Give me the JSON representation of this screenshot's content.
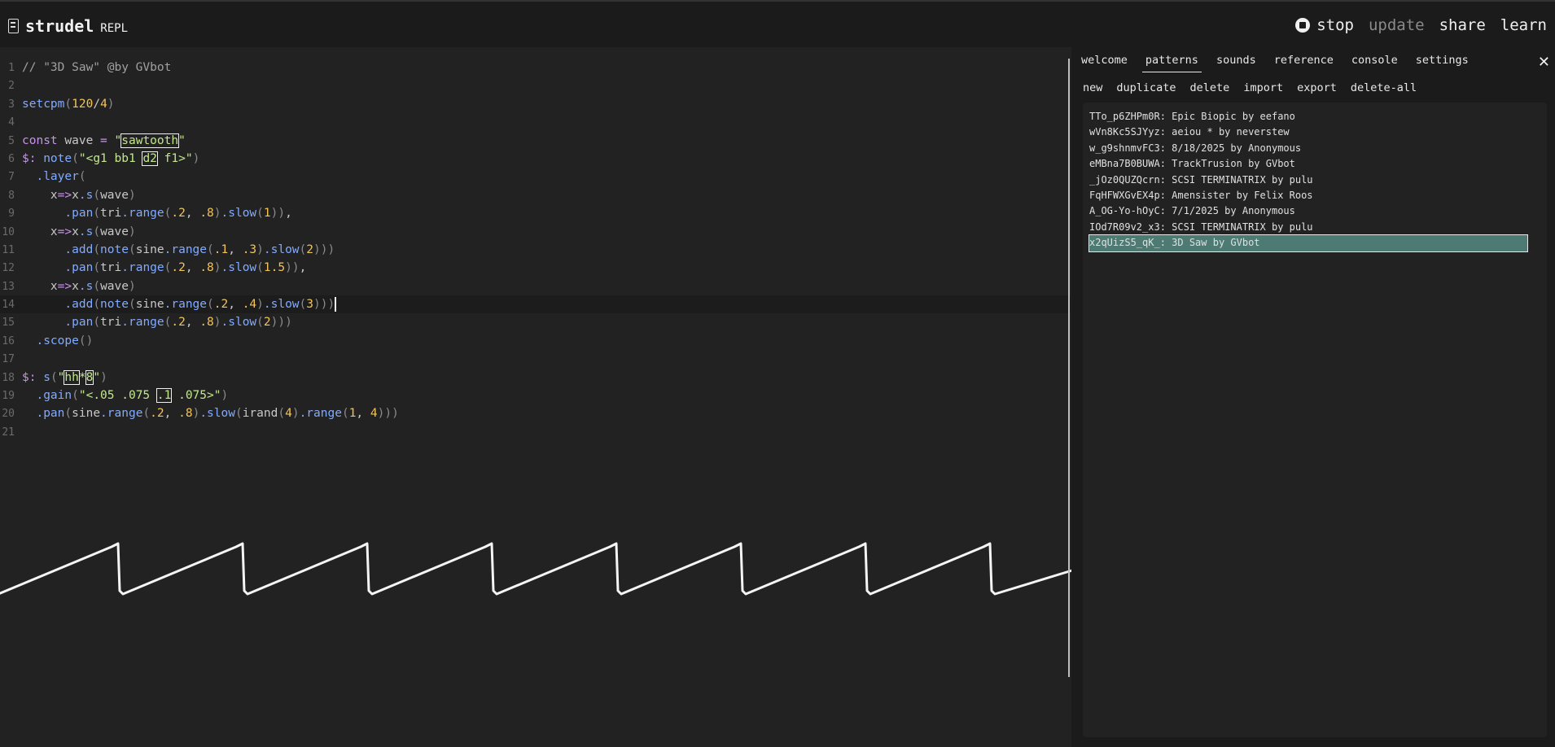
{
  "header": {
    "app_name": "strudel",
    "app_sub": "REPL",
    "logo_icon": "strudel-logo-icon",
    "stop_label": "stop",
    "update_label": "update",
    "share_label": "share",
    "learn_label": "learn"
  },
  "editor": {
    "line_numbers": [
      "1",
      "2",
      "3",
      "4",
      "5",
      "6",
      "7",
      "8",
      "9",
      "10",
      "11",
      "12",
      "13",
      "14",
      "15",
      "16",
      "17",
      "18",
      "19",
      "20",
      "21"
    ],
    "active_line": 14
  },
  "panel": {
    "tabs": [
      "welcome",
      "patterns",
      "sounds",
      "reference",
      "console",
      "settings"
    ],
    "active_tab": "patterns",
    "close_icon": "close-icon",
    "actions": [
      "new",
      "duplicate",
      "delete",
      "import",
      "export",
      "delete-all"
    ],
    "patterns": [
      "TTo_p6ZHPm0R: Epic Biopic by eefano",
      "wVn8Kc5SJYyz: aeiou * by neverstew",
      "w_g9shnmvFC3: 8/18/2025 by Anonymous",
      "eMBna7B0BUWA: TrackTrusion by GVbot",
      "_jOz0QUZQcrn: SCSI TERMINATRIX by pulu",
      "FqHFWXGvEX4p: Amensister by Felix Roos",
      "A_OG-Yo-hOyC: 7/1/2025 by Anonymous",
      "IOd7R09v2_x3: SCSI TERMINATRIX by pulu",
      "x2qUizS5_qK_: 3D Saw by GVbot"
    ],
    "selected_index": 8
  },
  "colors": {
    "background": "#222222",
    "header_bg": "#1b1b1b",
    "selected_row": "#4d7a72",
    "keyword": "#c792ea",
    "string": "#c3e88d",
    "number": "#f2c45a"
  }
}
